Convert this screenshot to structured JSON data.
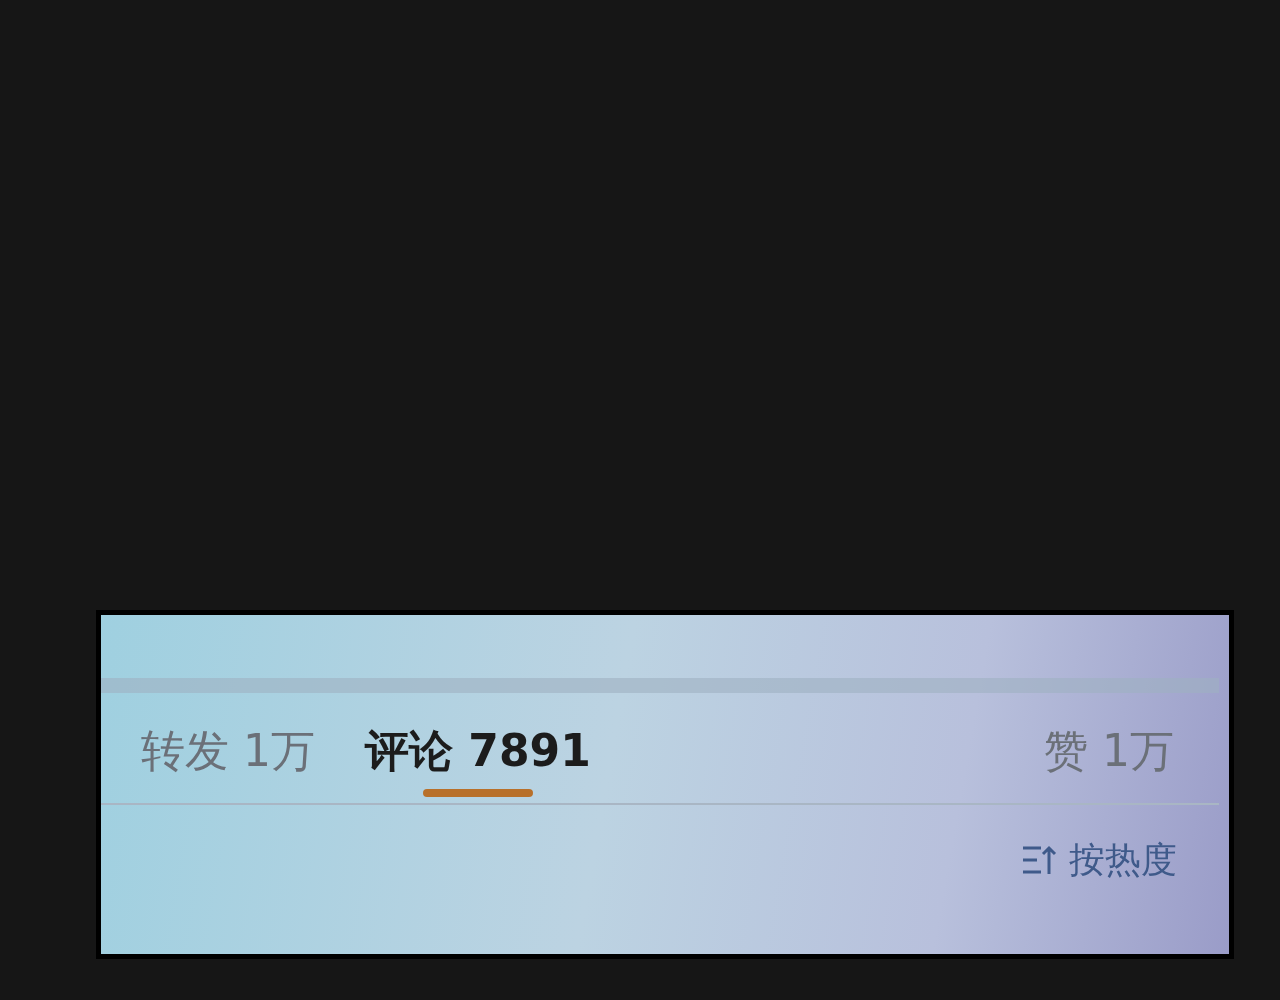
{
  "tabs": [
    {
      "label": "转发 1万",
      "selected": false
    },
    {
      "label": "评论 7891",
      "selected": true
    },
    {
      "label": "赞 1万",
      "selected": false
    }
  ],
  "sort": {
    "label": "按热度"
  }
}
